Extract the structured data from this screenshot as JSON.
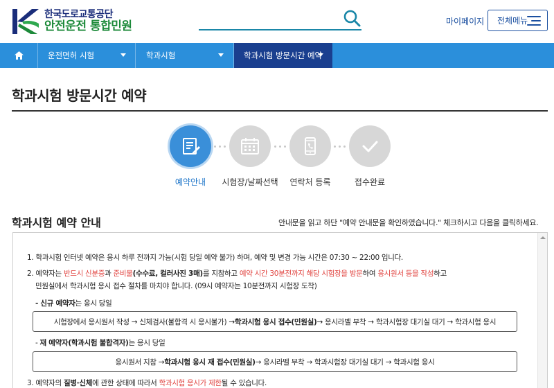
{
  "header": {
    "logo_line1": "한국도로교통공단",
    "logo_line2": "안전운전 통합민원",
    "search_placeholder": "",
    "mypage_label": "마이페이지",
    "allmenu_label": "전체메뉴"
  },
  "nav": {
    "items": [
      {
        "label": "운전면허 시험"
      },
      {
        "label": "학과시험"
      },
      {
        "label": "학과시험 방문시간 예약"
      }
    ]
  },
  "page": {
    "title": "학과시험 방문시간 예약"
  },
  "steps": [
    {
      "label": "예약안내",
      "icon": "document-edit-icon",
      "active": true
    },
    {
      "label": "시험장/날짜선택",
      "icon": "calendar-icon",
      "active": false
    },
    {
      "label": "연락처 등록",
      "icon": "phone-icon",
      "active": false
    },
    {
      "label": "접수완료",
      "icon": "checkmark-icon",
      "active": false
    }
  ],
  "guide": {
    "title": "학과시험 예약 안내",
    "note": "안내문을 읽고 하단 \"예약 안내문을 확인하였습니다.\" 체크하시고 다음을 클릭하세요.",
    "item1": "1. 학과시험 인터넷 예약은 응시 하루 전까지 가능(시험 당일 예약 불가) 하며, 예약 및 변경 가능 시간은 07:30 ~ 22:00 입니다.",
    "item2": {
      "p1": "2. 예약자는 ",
      "p2": "반드시 신분증",
      "p3": "과 ",
      "p4": "준비물",
      "p5": "(수수료, 컬러사진 3매)",
      "p6": "를 지참하고 ",
      "p7": "예약 시간 30분전까지 해당 시험장을 방문",
      "p8": "하여 ",
      "p9": "응시원서 등을 작성",
      "p10": "하고",
      "line2": "민원실에서 학과시험 응시 접수 절차를 마치야 합니다. (09시 예약자는 10분전까지 시험장 도착)"
    },
    "new_label_b": "- 신규 예약자",
    "new_label_rest": "는 응시 당일",
    "new_flow": {
      "a": "시험장에서 응시원서 작성 → 신체검사(불합격 시 응시불가) → ",
      "b": "학과시험 응시 접수(민원실)",
      "c": " → 응시라벨 부착 → 학과시험장 대기실 대기 → 학과시험 응시"
    },
    "re_label_b": "재 예약자(학과시험 불합격자)",
    "re_label_pre": "- ",
    "re_label_rest": "는 응시 당일",
    "re_flow": {
      "a": "응시원서 지참 → ",
      "b": "학과시험 응시 재 접수(민원실)",
      "c": " → 응시라벨 부착 → 학과시험장 대기실 대기 → 학과시험 응시"
    },
    "item3": {
      "p1": "3. 예약자의 ",
      "p2": "질병·신체",
      "p3": "에 관한 상태에 따라서 ",
      "p4": "학과시험 응시가 제한",
      "p5": "될 수 있습니다."
    }
  },
  "colors": {
    "nav_bg": "#2b8fdb",
    "nav_active_bg": "#1a3f8f",
    "step_active": "#3a8fd9",
    "step_inactive": "#d7d7d7",
    "accent_red": "#e0413d",
    "brand_blue": "#1a4fa0",
    "brand_green": "#1d8a3a"
  }
}
